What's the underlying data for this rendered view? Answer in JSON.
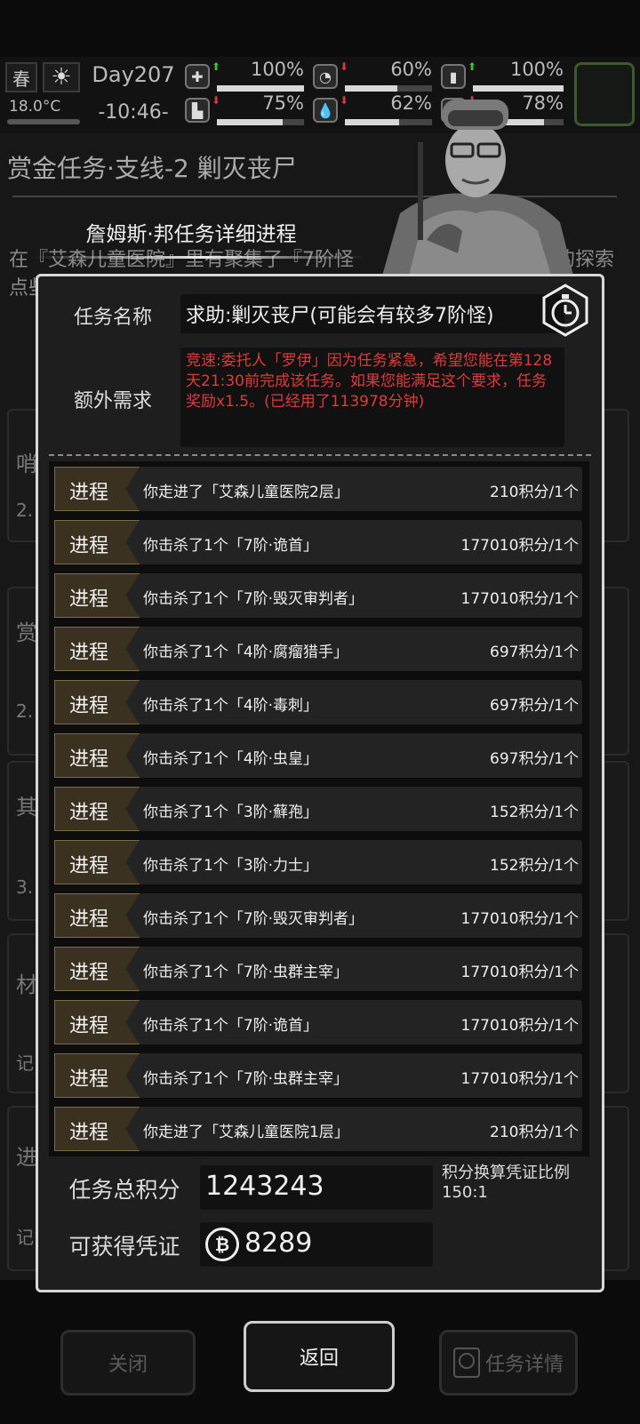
{
  "hud": {
    "season": "春",
    "weather_icon": "sun-icon",
    "temperature": "18.0°C",
    "day": "Day207",
    "time": "-10:46-",
    "stats": [
      {
        "icon": "medkit-icon",
        "trend": "up",
        "pct_text": "100%",
        "value": 100
      },
      {
        "icon": "stomach-icon",
        "trend": "down",
        "pct_text": "60%",
        "value": 60
      },
      {
        "icon": "battery-icon",
        "trend": "up",
        "pct_text": "100%",
        "value": 100
      },
      {
        "icon": "boot-icon",
        "trend": "down",
        "pct_text": "75%",
        "value": 75
      },
      {
        "icon": "water-drop-icon",
        "trend": "down",
        "pct_text": "62%",
        "value": 62
      },
      {
        "icon": "mood-icon",
        "trend": "down",
        "pct_text": "78%",
        "value": 78
      }
    ],
    "trend_colors": {
      "up": "#3fbf3f",
      "down": "#d43a3a"
    }
  },
  "background": {
    "title": "赏金任务·支线-2 剿灭丧尸",
    "desc_partial_1": "在『艾森儿童医院』里有聚集了『7阶怪",
    "desc_partial_2": "的探索",
    "desc_partial_3": "点些",
    "card_labels": [
      "哨",
      "赏",
      "其",
      "材",
      "进"
    ],
    "card_sub": [
      "2.",
      "2.",
      "3.",
      "记",
      "记"
    ]
  },
  "modal": {
    "subtitle": "詹姆斯·邦任务详细进程",
    "name_label": "任务名称",
    "name_value": "求助:剿灭丧尸(可能会有较多7阶怪)",
    "extra_label": "额外需求",
    "extra_value": "竞速:委托人「罗伊」因为任务紧急，希望您能在第128天21:30前完成该任务。如果您能满足这个要求，任务奖励x1.5。(已经用了113978分钟)",
    "timer_icon": "stopwatch-icon",
    "extra_color": "#e03a3a",
    "progress_tag": "进程",
    "rows": [
      {
        "text": "你走进了「艾森儿童医院2层」",
        "points": "210积分/1个"
      },
      {
        "text": "你击杀了1个「7阶·诡首」",
        "points": "177010积分/1个"
      },
      {
        "text": "你击杀了1个「7阶·毁灭审判者」",
        "points": "177010积分/1个"
      },
      {
        "text": "你击杀了1个「4阶·腐瘤猎手」",
        "points": "697积分/1个"
      },
      {
        "text": "你击杀了1个「4阶·毒刺」",
        "points": "697积分/1个"
      },
      {
        "text": "你击杀了1个「4阶·虫皇」",
        "points": "697积分/1个"
      },
      {
        "text": "你击杀了1个「3阶·蘚孢」",
        "points": "152积分/1个"
      },
      {
        "text": "你击杀了1个「3阶·力士」",
        "points": "152积分/1个"
      },
      {
        "text": "你击杀了1个「7阶·毁灭审判者」",
        "points": "177010积分/1个"
      },
      {
        "text": "你击杀了1个「7阶·虫群主宰」",
        "points": "177010积分/1个"
      },
      {
        "text": "你击杀了1个「7阶·诡首」",
        "points": "177010积分/1个"
      },
      {
        "text": "你击杀了1个「7阶·虫群主宰」",
        "points": "177010积分/1个"
      },
      {
        "text": "你走进了「艾森儿童医院1层」",
        "points": "210积分/1个"
      }
    ],
    "total_label": "任务总积分",
    "total_value": "1243243",
    "ratio_label": "积分换算凭证比例",
    "ratio_value": "150:1",
    "voucher_label": "可获得凭证",
    "voucher_icon": "bitcoin-coin-icon",
    "voucher_value": "8289"
  },
  "buttons": {
    "close": "关闭",
    "back": "返回",
    "detail": "任务详情"
  }
}
